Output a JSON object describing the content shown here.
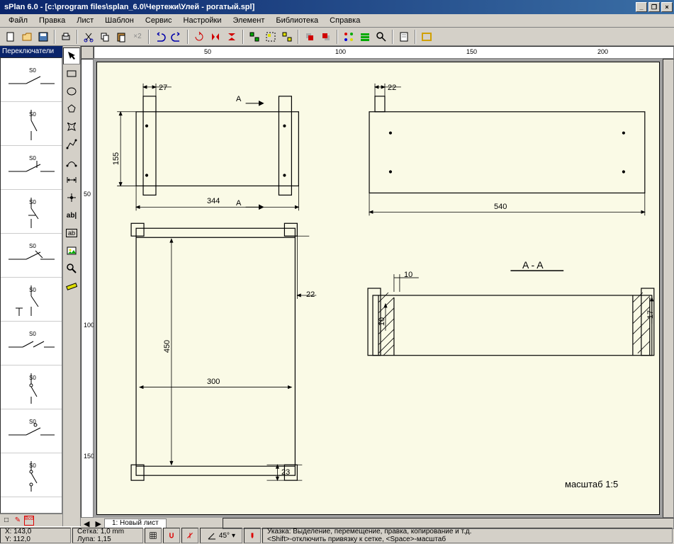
{
  "title": "sPlan 6.0 - [c:\\program files\\splan_6.0\\Чертежи\\Улей - рогатый.spl]",
  "menu": [
    "Файл",
    "Правка",
    "Лист",
    "Шаблон",
    "Сервис",
    "Настройки",
    "Элемент",
    "Библиотека",
    "Справка"
  ],
  "sidebar": {
    "category": "Переключатели",
    "symbols": [
      "S0",
      "S0",
      "S0",
      "S0",
      "S0",
      "S0",
      "S0",
      "S0",
      "S0",
      "S0"
    ]
  },
  "ruler_top": [
    "50",
    "100",
    "150",
    "200"
  ],
  "ruler_left": [
    "50",
    "100",
    "150"
  ],
  "drawing": {
    "dims": {
      "d27": "27",
      "d22a": "22",
      "d155": "155",
      "d344": "344",
      "d540": "540",
      "d22b": "22",
      "d450": "450",
      "d300": "300",
      "d23": "23",
      "d10a": "10",
      "d10b": "10",
      "d17": "17",
      "section": "A - A",
      "sectionA1": "A",
      "sectionA2": "A",
      "scale": "масштаб  1:5"
    }
  },
  "tab": "1: Новый лист",
  "status": {
    "x": "X: 143,0",
    "y": "Y: 112,0",
    "grid": "Сетка: 1,0 mm",
    "zoom": "Лупа: 1,15",
    "angle": "45°",
    "hint": "Указка: Выделение, перемещение, правка, копирование и т.д.",
    "hint2": "<Shift>-отключить привязку к сетке, <Space>-масштаб"
  }
}
